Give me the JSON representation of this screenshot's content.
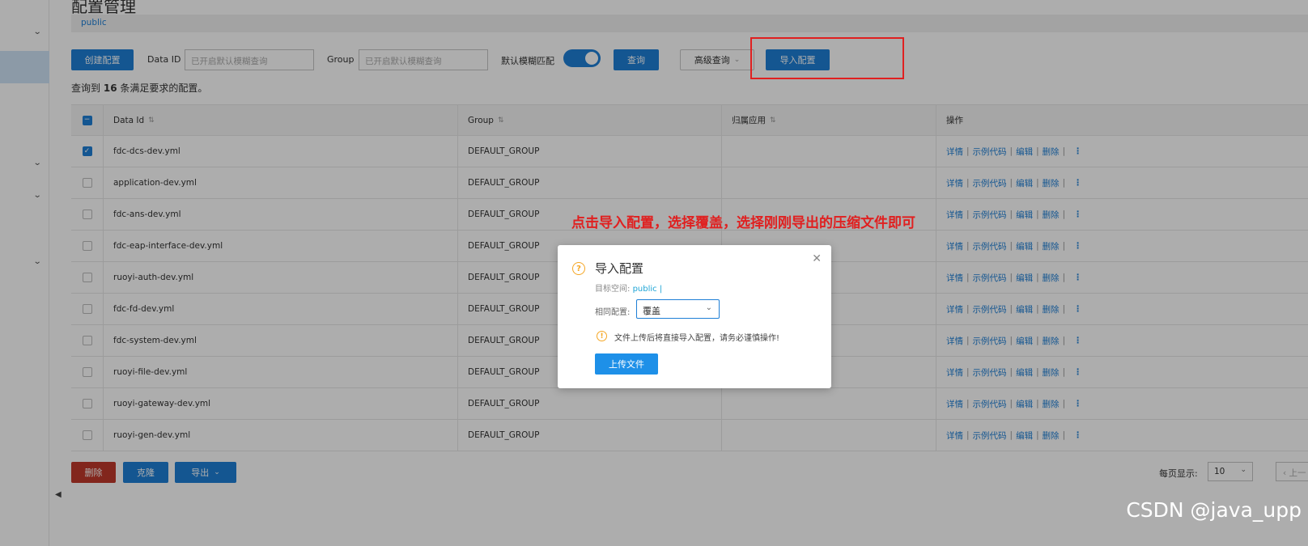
{
  "page": {
    "title": "配置管理",
    "namespace": "public"
  },
  "toolbar": {
    "create_label": "创建配置",
    "data_id_label": "Data ID",
    "data_id_placeholder": "已开启默认模糊查询",
    "group_label": "Group",
    "group_placeholder": "已开启默认模糊查询",
    "fuzzy_label": "默认模糊匹配",
    "fuzzy_on": true,
    "search_label": "查询",
    "advanced_label": "高级查询",
    "import_label": "导入配置"
  },
  "result": {
    "prefix": "查询到",
    "count": "16",
    "suffix": "条满足要求的配置。"
  },
  "table": {
    "headers": {
      "data_id": "Data Id",
      "group": "Group",
      "app": "归属应用",
      "ops": "操作"
    },
    "ops": {
      "detail": "详情",
      "sample": "示例代码",
      "edit": "编辑",
      "delete": "删除"
    },
    "rows": [
      {
        "data_id": "fdc-dcs-dev.yml",
        "group": "DEFAULT_GROUP",
        "checked": true
      },
      {
        "data_id": "application-dev.yml",
        "group": "DEFAULT_GROUP",
        "checked": false
      },
      {
        "data_id": "fdc-ans-dev.yml",
        "group": "DEFAULT_GROUP",
        "checked": false
      },
      {
        "data_id": "fdc-eap-interface-dev.yml",
        "group": "DEFAULT_GROUP",
        "checked": false
      },
      {
        "data_id": "ruoyi-auth-dev.yml",
        "group": "DEFAULT_GROUP",
        "checked": false
      },
      {
        "data_id": "fdc-fd-dev.yml",
        "group": "DEFAULT_GROUP",
        "checked": false
      },
      {
        "data_id": "fdc-system-dev.yml",
        "group": "DEFAULT_GROUP",
        "checked": false
      },
      {
        "data_id": "ruoyi-file-dev.yml",
        "group": "DEFAULT_GROUP",
        "checked": false
      },
      {
        "data_id": "ruoyi-gateway-dev.yml",
        "group": "DEFAULT_GROUP",
        "checked": false
      },
      {
        "data_id": "ruoyi-gen-dev.yml",
        "group": "DEFAULT_GROUP",
        "checked": false
      }
    ]
  },
  "footer": {
    "delete_label": "删除",
    "clone_label": "克隆",
    "export_label": "导出",
    "page_size_label": "每页显示:",
    "page_size": "10",
    "prev_label": "上一"
  },
  "annotation": "点击导入配置，选择覆盖，选择刚刚导出的压缩文件即可",
  "dialog": {
    "title": "导入配置",
    "target_label": "目标空间:",
    "target_value": "public",
    "target_suffix": "|",
    "same_label": "相同配置:",
    "same_value": "覆盖",
    "warning": "文件上传后将直接导入配置，请务必谨慎操作!",
    "upload_label": "上传文件"
  },
  "watermark": "CSDN @java_upp",
  "colors": {
    "primary": "#1e7fd6",
    "danger": "#c0392b",
    "annotation_red": "#e02020",
    "warning": "#f5a623"
  }
}
